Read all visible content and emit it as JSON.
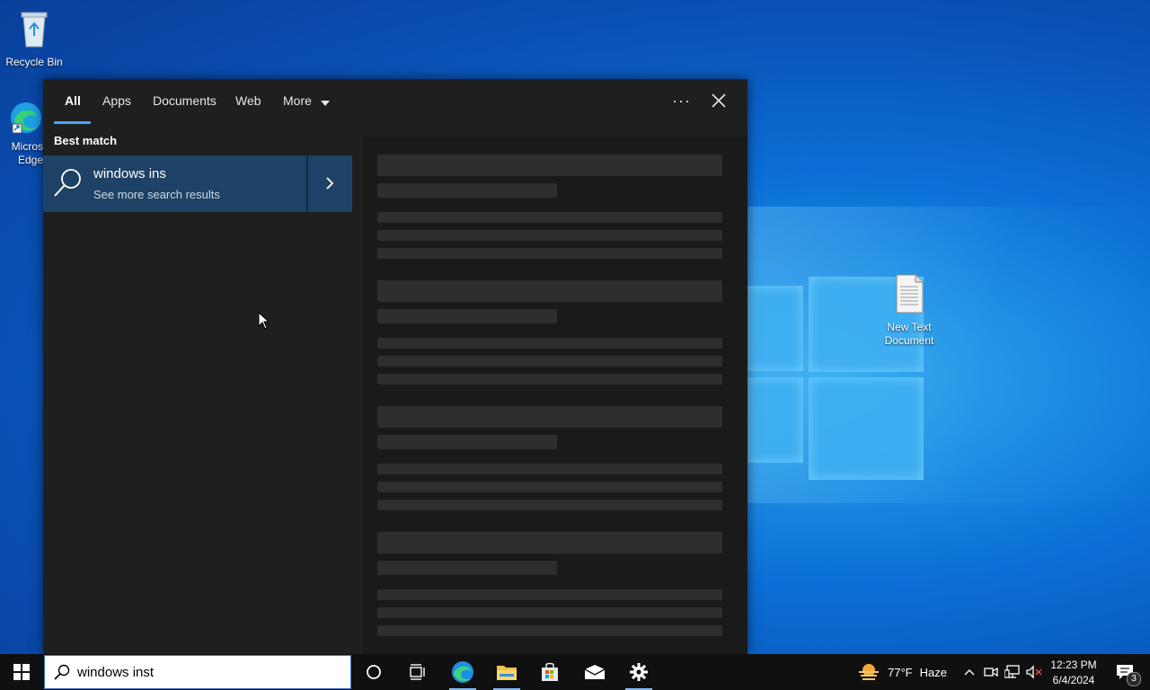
{
  "desktop": {
    "icons": [
      {
        "label": "Recycle Bin"
      },
      {
        "label": "Micros\nEdge"
      },
      {
        "label": "New Text Document"
      }
    ]
  },
  "search_panel": {
    "tabs": [
      {
        "label": "All"
      },
      {
        "label": "Apps"
      },
      {
        "label": "Documents"
      },
      {
        "label": "Web"
      },
      {
        "label": "More"
      }
    ],
    "options_label": "···",
    "section_label": "Best match",
    "best_match": {
      "title": "windows ins",
      "subtitle": "See more search results"
    }
  },
  "taskbar": {
    "search_value": "windows inst",
    "weather": {
      "temp": "77°F",
      "condition": "Haze"
    },
    "clock": {
      "time": "12:23 PM",
      "date": "6/4/2024"
    },
    "notification_count": "3"
  },
  "colors": {
    "accent": "#4aa3ff",
    "panel_bg": "#1f1f1f",
    "selected_bg": "#1e4266",
    "taskbar_bg": "#101010"
  }
}
